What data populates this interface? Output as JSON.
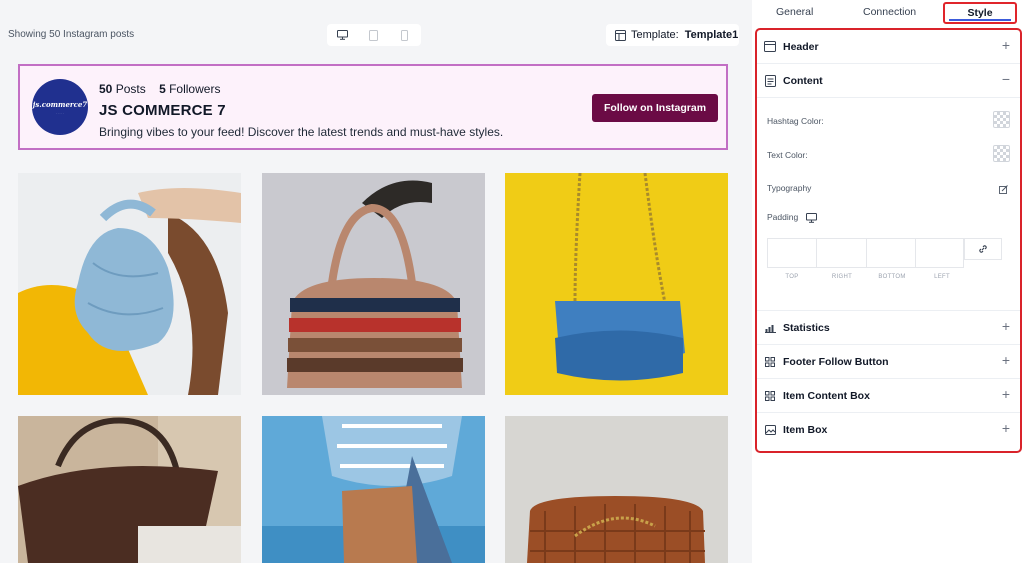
{
  "toolbar": {
    "showing_text": "Showing 50 Instagram posts",
    "devices": [
      "desktop-icon",
      "tablet-icon",
      "mobile-icon"
    ],
    "template_label": "Template:",
    "template_value": "Template1"
  },
  "profile": {
    "avatar_text": "js.commerce7",
    "avatar_subtext": "· · · · ·",
    "posts_count": "50",
    "posts_label": "Posts",
    "followers_count": "5",
    "followers_label": "Followers",
    "name": "JS COMMERCE 7",
    "bio": "Bringing vibes to your feed! Discover the latest trends and must-have styles.",
    "follow_button": "Follow on Instagram"
  },
  "feed": {
    "posts": [
      {
        "subject": "light-blue ruched bag",
        "bg": "#e9ecef",
        "accent": "#f4b400",
        "bag": "#8fb8d6"
      },
      {
        "subject": "striped leather tote",
        "bg": "#c9c9cf",
        "accent": "#2d2a27",
        "bag": "#b9876e"
      },
      {
        "subject": "blue chain bag",
        "bg": "#f0cc16",
        "accent": "#f0cc16",
        "bag": "#3f7fc0"
      },
      {
        "subject": "dark brown tote",
        "bg": "#c9b59c",
        "accent": "#3a2a22",
        "bag": "#4b2d22"
      },
      {
        "subject": "tan crossbody bag",
        "bg": "#5fa9d8",
        "accent": "#9cc6e4",
        "bag": "#b87a4f"
      },
      {
        "subject": "woven brown bag",
        "bg": "#d7d6d2",
        "accent": "#8c4a22",
        "bag": "#9b4e26"
      }
    ]
  },
  "panel": {
    "tabs": {
      "general": "General",
      "connection": "Connection",
      "style": "Style"
    },
    "sections": {
      "header": "Header",
      "content": "Content",
      "statistics": "Statistics",
      "footer_follow_button": "Footer Follow Button",
      "item_content_box": "Item Content Box",
      "item_box": "Item Box"
    },
    "content": {
      "hashtag_color": "Hashtag Color:",
      "text_color": "Text Color:",
      "typography": "Typography",
      "padding": "Padding",
      "padding_top": "TOP",
      "padding_right": "RIGHT",
      "padding_bottom": "BOTTOM",
      "padding_left": "LEFT"
    },
    "toggle_expand": "+",
    "toggle_collapse": "−"
  },
  "colors": {
    "follow_button_bg": "#6b0b45",
    "profile_border": "#c26fc4",
    "profile_bg": "#fdf2fb",
    "highlight_red": "#d9232a"
  }
}
